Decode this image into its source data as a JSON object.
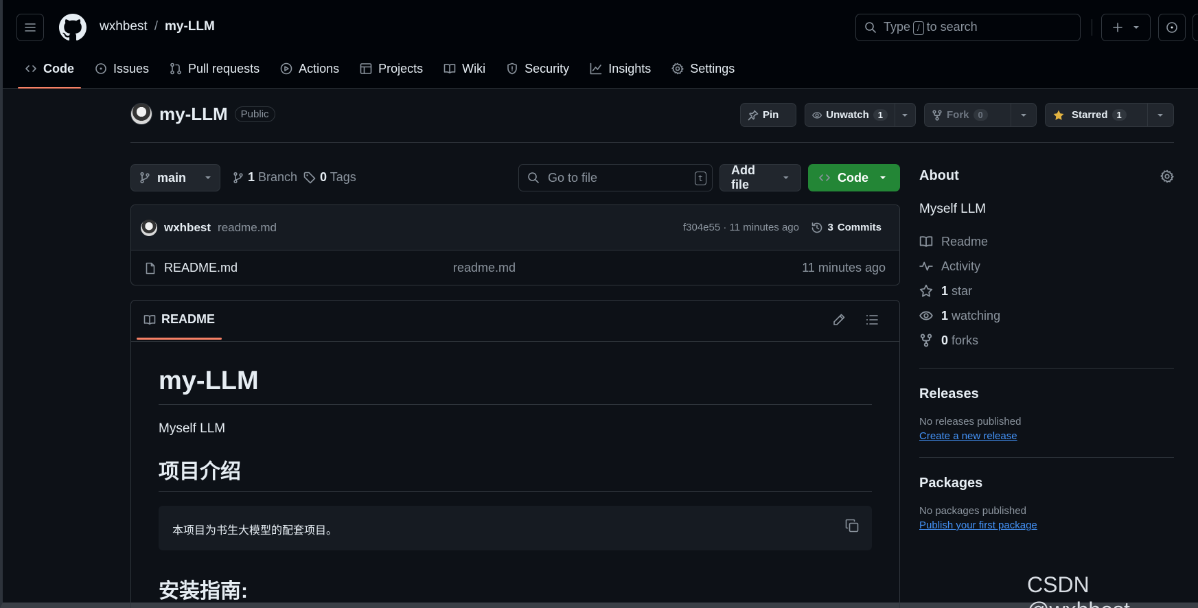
{
  "header": {
    "owner": "wxhbest",
    "separator": "/",
    "repo": "my-LLM",
    "search": {
      "prefix": "Type",
      "key": "/",
      "suffix": "to search"
    },
    "icons": [
      "hamburger-icon",
      "github-logo",
      "search-icon",
      "plus-icon",
      "issue-opened-icon"
    ]
  },
  "tabs": [
    {
      "label": "Code",
      "icon": "code-icon",
      "active": true
    },
    {
      "label": "Issues",
      "icon": "issue-icon"
    },
    {
      "label": "Pull requests",
      "icon": "pull-request-icon"
    },
    {
      "label": "Actions",
      "icon": "play-icon"
    },
    {
      "label": "Projects",
      "icon": "table-icon"
    },
    {
      "label": "Wiki",
      "icon": "book-icon"
    },
    {
      "label": "Security",
      "icon": "shield-icon"
    },
    {
      "label": "Insights",
      "icon": "graph-icon"
    },
    {
      "label": "Settings",
      "icon": "gear-icon"
    }
  ],
  "repo_head": {
    "name": "my-LLM",
    "visibility": "Public",
    "pin": "Pin",
    "unwatch": "Unwatch",
    "watch_count": "1",
    "fork": "Fork",
    "fork_count": "0",
    "starred": "Starred",
    "star_count": "1"
  },
  "filebar": {
    "branch": "main",
    "branches_count": "1",
    "branches_label": "Branch",
    "tags_count": "0",
    "tags_label": "Tags",
    "goto_placeholder": "Go to file",
    "goto_key": "t",
    "add_file": "Add file",
    "code": "Code"
  },
  "commit": {
    "author": "wxhbest",
    "message": "readme.md",
    "sha_time": "f304e55 · 11 minutes ago",
    "commits_count": "3",
    "commits_label": "Commits"
  },
  "files": [
    {
      "name": "README.md",
      "message": "readme.md",
      "time": "11 minutes ago"
    }
  ],
  "readme": {
    "tab": "README",
    "h1": "my-LLM",
    "intro": "Myself LLM",
    "h2_intro": "项目介绍",
    "code_text": "本项目为书生大模型的配套项目。",
    "h2_install": "安装指南:"
  },
  "sidebar": {
    "about_title": "About",
    "description": "Myself LLM",
    "items": [
      {
        "icon": "book-icon",
        "count": "",
        "label": "Readme"
      },
      {
        "icon": "pulse-icon",
        "count": "",
        "label": "Activity"
      },
      {
        "icon": "star-icon",
        "count": "1",
        "label": "star"
      },
      {
        "icon": "eye-icon",
        "count": "1",
        "label": "watching"
      },
      {
        "icon": "fork-icon",
        "count": "0",
        "label": "forks"
      }
    ],
    "releases_title": "Releases",
    "releases_text": "No releases published",
    "releases_link": "Create a new release",
    "packages_title": "Packages",
    "packages_text": "No packages published",
    "packages_link": "Publish your first package"
  },
  "watermark": "CSDN @wxhbest",
  "colors": {
    "background": "#0d1117",
    "header_bg": "#010409",
    "border": "#30363d",
    "tab_underline": "#f78166",
    "code_button": "#238636",
    "link": "#4493f8",
    "star": "#e3b341"
  }
}
